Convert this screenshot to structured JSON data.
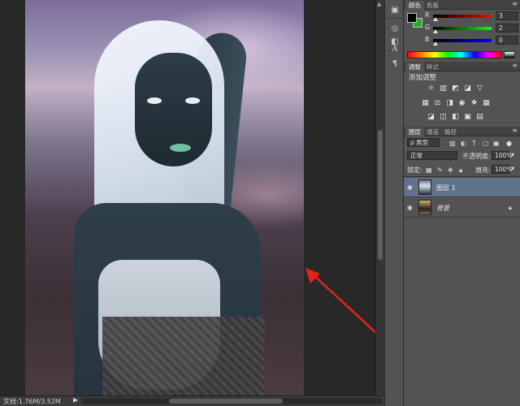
{
  "status": {
    "doc_info": "文档:1.76M/3.52M",
    "arrow": "▶"
  },
  "color_panel": {
    "tabs": [
      "颜色",
      "色板"
    ],
    "active_tab": 0,
    "fg_color": "#000000",
    "bg_color": "#22b022",
    "sliders": [
      {
        "label": "R",
        "value": "3",
        "gradient": "linear-gradient(90deg,#000,#ff0000)"
      },
      {
        "label": "G",
        "value": "2",
        "gradient": "linear-gradient(90deg,#000,#00ff00)"
      },
      {
        "label": "B",
        "value": "0",
        "gradient": "linear-gradient(90deg,#000,#0000ff)"
      }
    ]
  },
  "adjustments_panel": {
    "tabs": [
      "调整",
      "样式"
    ],
    "active_tab": 0,
    "title": "添加调整",
    "row1_icons": [
      "brightness-icon",
      "levels-icon",
      "curves-icon",
      "exposure-icon",
      "vibrance-icon"
    ],
    "row2_icons": [
      "hue-saturation-icon",
      "color-balance-icon",
      "black-white-icon",
      "photo-filter-icon",
      "channel-mixer-icon",
      "color-lookup-icon"
    ],
    "row3_icons": [
      "invert-icon",
      "posterize-icon",
      "threshold-icon",
      "selective-color-icon",
      "gradient-map-icon"
    ]
  },
  "layers_panel": {
    "tabs": [
      "图层",
      "通道",
      "路径"
    ],
    "active_tab": 0,
    "filter_type": "ρ 类型",
    "blend_mode": "正常",
    "opacity_label": "不透明度:",
    "opacity_value": "100%",
    "lock_label": "锁定:",
    "fill_label": "填充:",
    "fill_value": "100%",
    "layers": [
      {
        "name": "图层 1",
        "selected": true
      },
      {
        "name": "背景",
        "selected": false,
        "locked": true
      }
    ]
  },
  "accent_color": "#60728b"
}
